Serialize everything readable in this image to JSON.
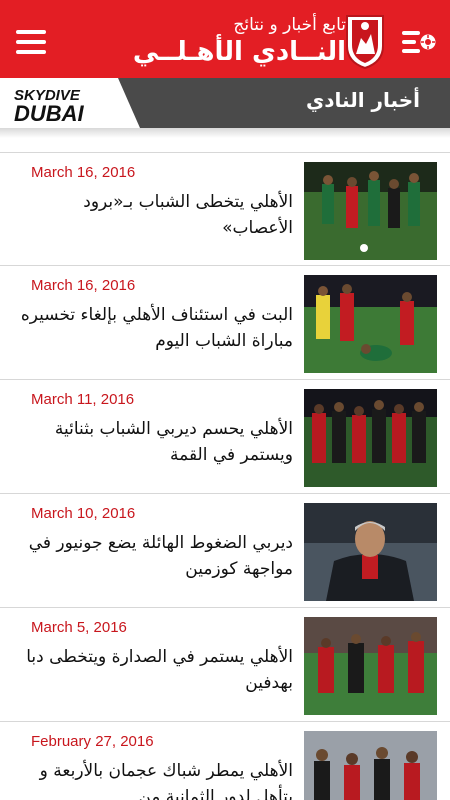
{
  "header": {
    "subtitle": "تابع أخبار و نتائج",
    "title": "النــادي الأهـلــي",
    "crest_text": "AL AHLI",
    "menu_icon": "hamburger-menu-icon",
    "sports_icon": "sports-menu-icon",
    "brand_color": "#e31e24"
  },
  "sponsor": {
    "text_top": "SKYDIVE",
    "text_bottom": "DUBAI"
  },
  "section": {
    "title": "أخبار النادي"
  },
  "news": [
    {
      "date": "March 16, 2016",
      "title": "الأهلي يتخطى الشباب بـ«برود الأعصاب»",
      "thumb_desc": "green-red-players"
    },
    {
      "date": "March 16, 2016",
      "title": "البت في استئناف الأهلي بإلغاء تخسيره مباراة الشباب اليوم",
      "thumb_desc": "referee-player-kneeling"
    },
    {
      "date": "March 11, 2016",
      "title": "الأهلي يحسم ديربي الشباب بثنائية ويستمر في القمة",
      "thumb_desc": "team-celebration"
    },
    {
      "date": "March 10, 2016",
      "title": "ديربي الضغوط الهائلة يضع جونيور في مواجهة كوزمين",
      "thumb_desc": "coach-portrait"
    },
    {
      "date": "March 5, 2016",
      "title": "الأهلي يستمر في الصدارة ويتخطى دبا بهدفين",
      "thumb_desc": "players-celebrating"
    },
    {
      "date": "February 27, 2016",
      "title": "الأهلي يمطر شباك عجمان بالأربعة و يتأهل لدور الثمانية من",
      "thumb_desc": "players-clapping"
    }
  ]
}
